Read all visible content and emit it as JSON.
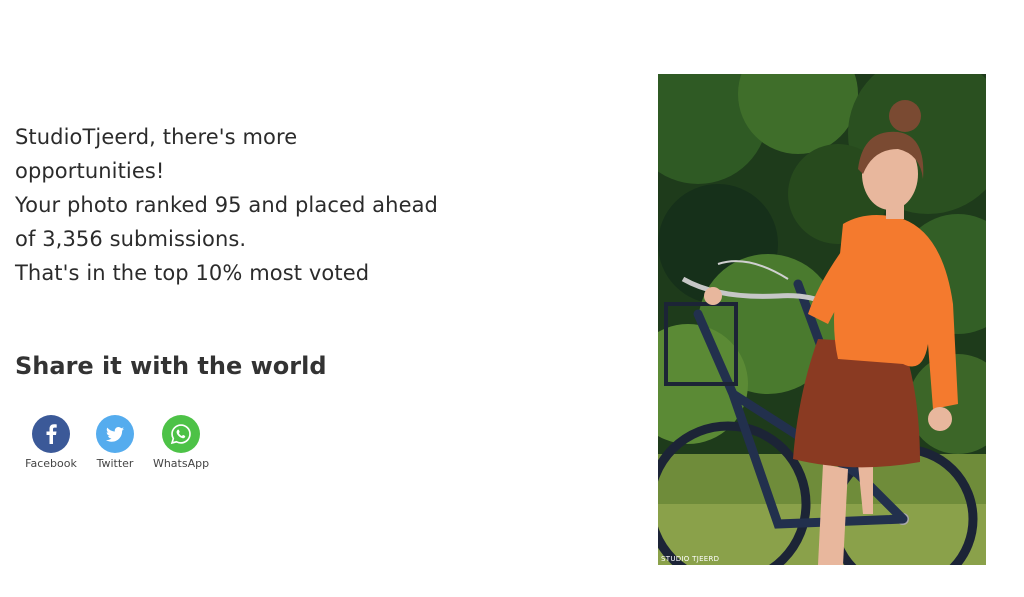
{
  "message": {
    "lines": [
      "StudioTjeerd, there's more",
      "opportunities!",
      "Your photo ranked 95 and placed ahead",
      "of 3,356 submissions.",
      "That's in the top 10% most voted"
    ]
  },
  "share": {
    "title": "Share it with the world",
    "buttons": [
      {
        "label": "Facebook",
        "icon": "facebook-icon",
        "color": "#3b5998"
      },
      {
        "label": "Twitter",
        "icon": "twitter-icon",
        "color": "#55acee"
      },
      {
        "label": "WhatsApp",
        "icon": "whatsapp-icon",
        "color": "#4dc247"
      }
    ]
  },
  "photo": {
    "watermark": "STUDIO TJEERD"
  }
}
